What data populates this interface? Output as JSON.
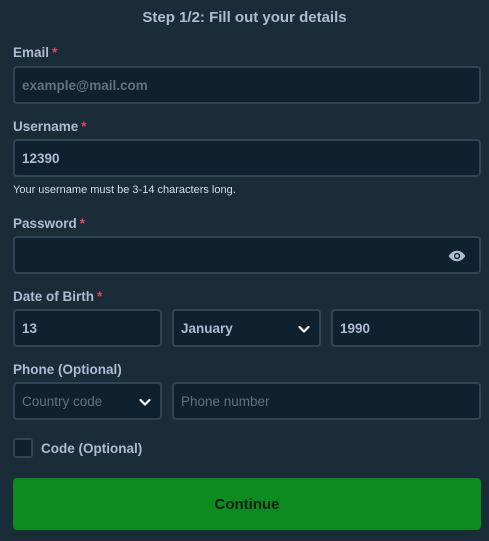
{
  "header": {
    "title": "Step 1/2: Fill out your details"
  },
  "email": {
    "label": "Email",
    "required_mark": "*",
    "placeholder": "example@mail.com"
  },
  "username": {
    "label": "Username",
    "required_mark": "*",
    "value": "12390",
    "hint": "Your username must be 3-14 characters long."
  },
  "password": {
    "label": "Password",
    "required_mark": "*",
    "value": "",
    "toggle_icon": "eye-icon"
  },
  "dob": {
    "label": "Date of Birth",
    "required_mark": "*",
    "day": "13",
    "month": "January",
    "year": "1990"
  },
  "phone": {
    "label": "Phone (Optional)",
    "country_placeholder": "Country code",
    "number_placeholder": "Phone number"
  },
  "code": {
    "label": "Code (Optional)",
    "checked": false
  },
  "actions": {
    "continue_label": "Continue"
  },
  "colors": {
    "background": "#1a2c38",
    "input_bg": "#0f212e",
    "border": "#2f4553",
    "accent_green": "#0c8b21",
    "required_red": "#ed4163"
  }
}
